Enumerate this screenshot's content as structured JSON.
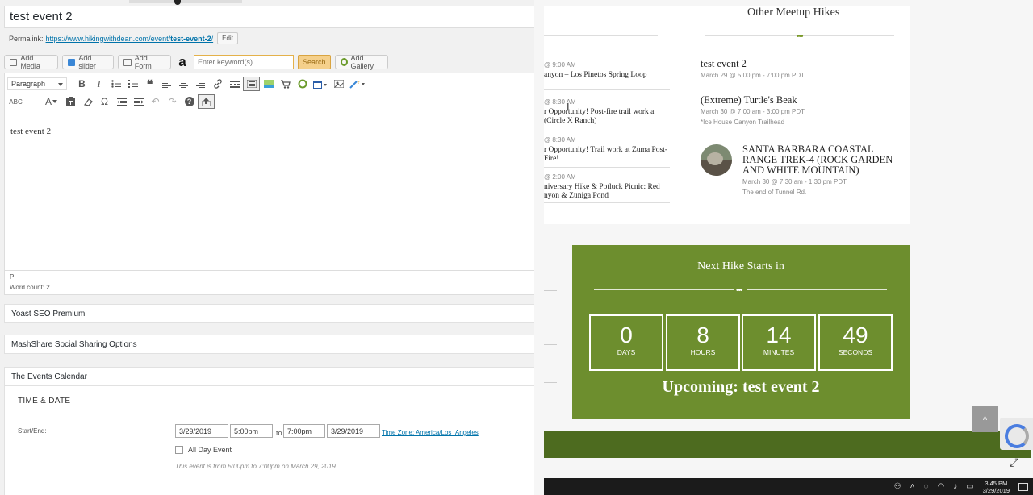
{
  "editor": {
    "post_title": "test event 2",
    "permalink": {
      "label": "Permalink:",
      "url_base": "https://www.hikingwithdean.com/event/",
      "slug": "test-event-2",
      "trailing": "/",
      "edit_label": "Edit"
    },
    "media_buttons": {
      "add_media": "Add Media",
      "add_slider": "Add slider",
      "add_form": "Add Form",
      "amazon_icon": "a",
      "keyword_placeholder": "Enter keyword(s)",
      "search": "Search",
      "add_gallery": "Add Gallery"
    },
    "toolbar": {
      "format_select": "Paragraph",
      "row1_icons": [
        "bold-icon",
        "italic-icon",
        "bullet-list-icon",
        "numbered-list-icon",
        "blockquote-icon",
        "align-left-icon",
        "align-center-icon",
        "align-right-icon",
        "link-icon",
        "read-more-icon",
        "toolbar-toggle-icon",
        "image-icon",
        "cart-icon",
        "circle-icon",
        "calendar-icon",
        "media-icon",
        "magic-wand-icon"
      ],
      "row2_icons": [
        "strikethrough-icon",
        "horizontal-line-icon",
        "text-color-icon",
        "paste-text-icon",
        "clear-format-icon",
        "special-char-icon",
        "outdent-icon",
        "indent-icon",
        "undo-icon",
        "redo-icon",
        "help-icon",
        "upload-icon"
      ],
      "glyphs": {
        "bold": "B",
        "italic": "I",
        "special_char": "Ω",
        "help": "?",
        "strikethrough": "ABC",
        "text_color": "A"
      }
    },
    "content": "test event 2",
    "path": "P",
    "word_count": "Word count: 2"
  },
  "metaboxes": {
    "yoast": "Yoast SEO Premium",
    "mashshare": "MashShare Social Sharing Options",
    "events_calendar": "The Events Calendar"
  },
  "events_calendar": {
    "section": "TIME & DATE",
    "start_end_label": "Start/End:",
    "start_date": "3/29/2019",
    "start_time": "5:00pm",
    "to": "to",
    "end_time": "7:00pm",
    "end_date": "3/29/2019",
    "timezone": "Time Zone: America/Los_Angeles",
    "all_day": "All Day Event",
    "note": "This event is from 5:00pm to 7:00pm on March 29, 2019."
  },
  "site": {
    "other_hikes_title": "Other Meetup Hikes",
    "dots": "•••",
    "left_column": [
      {
        "time": "@ 9:00 AM",
        "name": "anyon – Los Pinetos Spring Loop"
      },
      {
        "time": "@ 8:30 AM",
        "name": "r Opportunity! Post-fire trail work a (Circle X Ranch)"
      },
      {
        "time": "@ 8:30 AM",
        "name": "r Opportunity! Trail work at Zuma Post-Fire!"
      },
      {
        "time": "@ 2:00 AM",
        "name": "niversary Hike & Potluck Picnic: Red nyon & Zuniga Pond"
      }
    ],
    "events": [
      {
        "name": "test event 2",
        "date": "March 29 @ 5:00 pm - 7:00 pm PDT",
        "venue": ""
      },
      {
        "name": "(Extreme) Turtle's Beak",
        "date": "March 30 @ 7:00 am - 3:00 pm PDT",
        "venue": "*Ice House Canyon Trailhead"
      },
      {
        "name": "SANTA BARBARA COASTAL RANGE TREK-4 (ROCK GARDEN AND WHITE MOUNTAIN)",
        "date": "March 30 @ 7:30 am - 1:30 pm PDT",
        "venue": "The end of Tunnel Rd."
      }
    ],
    "countdown": {
      "title": "Next Hike Starts in",
      "units": [
        {
          "value": "0",
          "label": "DAYS"
        },
        {
          "value": "8",
          "label": "HOURS"
        },
        {
          "value": "14",
          "label": "MINUTES"
        },
        {
          "value": "49",
          "label": "SECONDS"
        }
      ],
      "upcoming": "Upcoming: test event 2"
    },
    "scroll_top_glyph": "˄",
    "expand_glyph": "⤢",
    "text_cursor": "I"
  },
  "taskbar": {
    "time": "3:45 PM",
    "date": "3/29/2019"
  },
  "colors": {
    "wp_link": "#0073aa",
    "green_panel": "#6d8e2e",
    "dark_green_band": "#4d6b1f",
    "taskbar": "#1b1b1b"
  }
}
